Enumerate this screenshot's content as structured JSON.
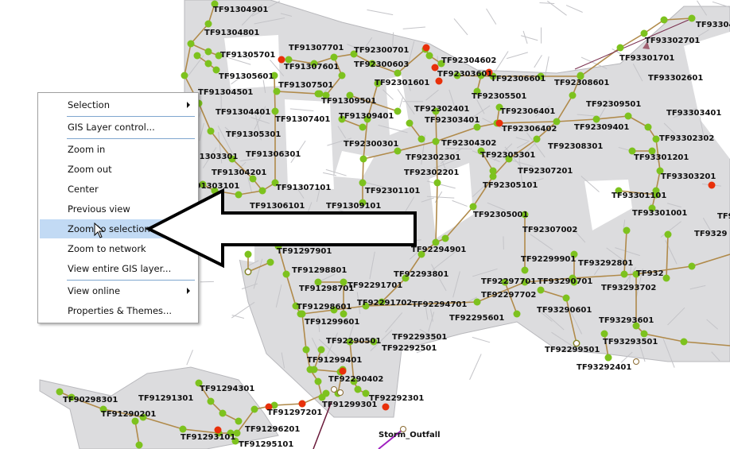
{
  "context_menu": {
    "items": [
      {
        "label": "Selection",
        "submenu": true
      },
      {
        "label": "GIS Layer control...",
        "submenu": false
      },
      {
        "label": "Zoom in",
        "submenu": false
      },
      {
        "label": "Zoom out",
        "submenu": false
      },
      {
        "label": "Center",
        "submenu": false
      },
      {
        "label": "Previous view",
        "submenu": false
      },
      {
        "label": "Zoom to selection",
        "submenu": false,
        "highlighted": true
      },
      {
        "label": "Zoom to network",
        "submenu": false
      },
      {
        "label": "View entire GIS layer...",
        "submenu": false
      },
      {
        "label": "View online",
        "submenu": true
      },
      {
        "label": "Properties & Themes...",
        "submenu": false
      }
    ]
  },
  "map": {
    "colors": {
      "subcatchment": "#dcdcde",
      "pipe": "#b08a4a",
      "node_ok": "#7dc21e",
      "node_flooded": "#e8300a",
      "outfall_link": "#a020c0"
    },
    "labels": [
      "TF91304901",
      "TF91304801",
      "TF91305701",
      "TF91305601",
      "TF91304501",
      "TF91304401",
      "TF91305301",
      "TF91306301",
      "TF91304201",
      "TF91306101",
      "TF91307101",
      "TF91307701",
      "TF91307601",
      "TF91307501",
      "TF91307401",
      "TF91309501",
      "TF91309401",
      "TF91309101",
      "TF92300701",
      "TF92300603",
      "TF92301601",
      "TF92300301",
      "TF92301101",
      "TF92302301",
      "TF92302201",
      "TF92302401",
      "TF92303401",
      "TF92304602",
      "TF92303601",
      "TF92306601",
      "TF92308601",
      "TF92305501",
      "TF92306401",
      "TF92306402",
      "TF92304302",
      "TF92305301",
      "TF92307201",
      "TF92305101",
      "TF92305001",
      "TF92307002",
      "TF92309501",
      "TF92309401",
      "TF92308301",
      "TF93304",
      "TF93302701",
      "TF93301701",
      "TF93302601",
      "TF93303401",
      "TF93302302",
      "TF93301201",
      "TF93303201",
      "TF93301101",
      "TF93301001",
      "TF9",
      "TF9329",
      "TF91297901",
      "TF91298801",
      "TF91298701",
      "TF91298601",
      "TF91299601",
      "TF91299401",
      "TF92290501",
      "TF92290402",
      "TF91299301",
      "TF92292301",
      "TF92293501",
      "TF92292501",
      "TF92291701",
      "TF92291702",
      "TF92293801",
      "TF92294901",
      "TF92294701",
      "TF92295601",
      "TF92299901",
      "TF92297701",
      "TF92297702",
      "TF92299501",
      "TF93292801",
      "TF93290701",
      "TF93293702",
      "TF93290601",
      "TF93293601",
      "TF93293501",
      "TF93292401",
      "TF932",
      "Storm_Outfall",
      "TF91297201",
      "TF91296201",
      "TF91295101",
      "TF91294301",
      "TF91291301",
      "TF90298301",
      "TF91290201",
      "TF91293101",
      "TF91303301",
      "TF91303101"
    ]
  }
}
